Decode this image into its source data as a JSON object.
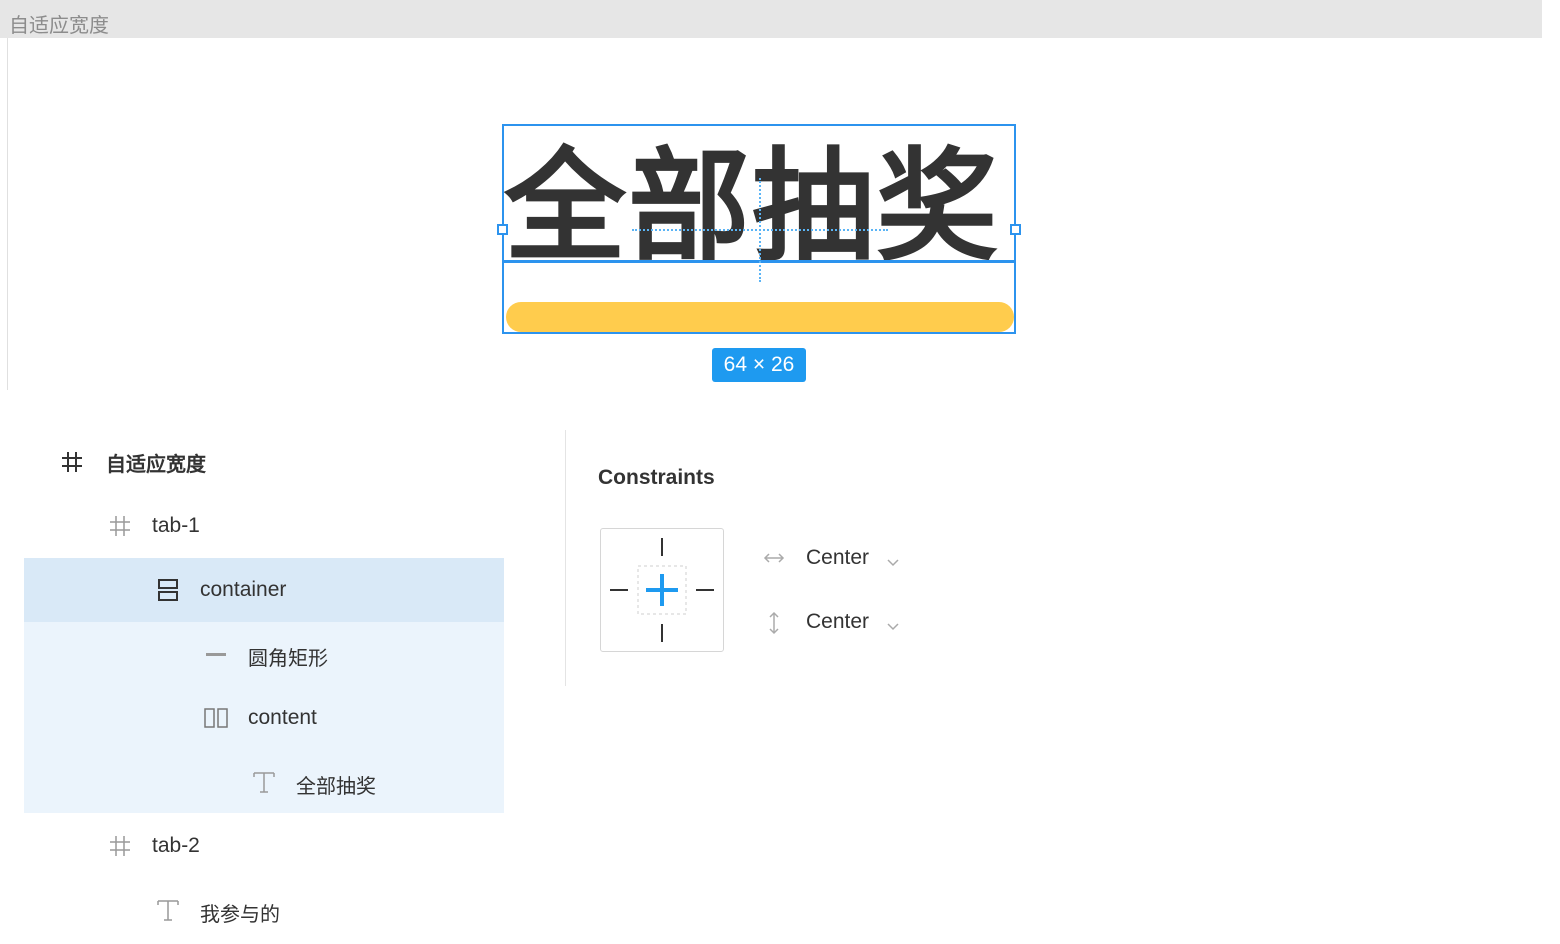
{
  "canvas": {
    "frame_title": "自适应宽度",
    "text_content": "全部抽奖",
    "dimension_badge": "64 × 26",
    "colors": {
      "selection": "#2c93ee",
      "pill": "#ffcc4d",
      "badge": "#1e9af0",
      "text": "#333333"
    }
  },
  "layers": [
    {
      "name": "自适应宽度",
      "icon": "frame-icon",
      "depth": 0,
      "selected": false
    },
    {
      "name": "tab-1",
      "icon": "frame-icon",
      "depth": 1,
      "selected": false
    },
    {
      "name": "container",
      "icon": "vertical-autolayout-icon",
      "depth": 2,
      "selected": true
    },
    {
      "name": "圆角矩形",
      "icon": "rectangle-icon",
      "depth": 3,
      "selected": false
    },
    {
      "name": "content",
      "icon": "horizontal-autolayout-icon",
      "depth": 3,
      "selected": false
    },
    {
      "name": "全部抽奖",
      "icon": "text-icon",
      "depth": 4,
      "selected": false
    },
    {
      "name": "tab-2",
      "icon": "frame-icon",
      "depth": 1,
      "selected": false
    },
    {
      "name": "我参与的",
      "icon": "text-icon",
      "depth": 2,
      "selected": false
    }
  ],
  "constraints": {
    "title": "Constraints",
    "horizontal": {
      "value": "Center",
      "icon": "horizontal-arrow-icon"
    },
    "vertical": {
      "value": "Center",
      "icon": "vertical-arrow-icon"
    }
  }
}
